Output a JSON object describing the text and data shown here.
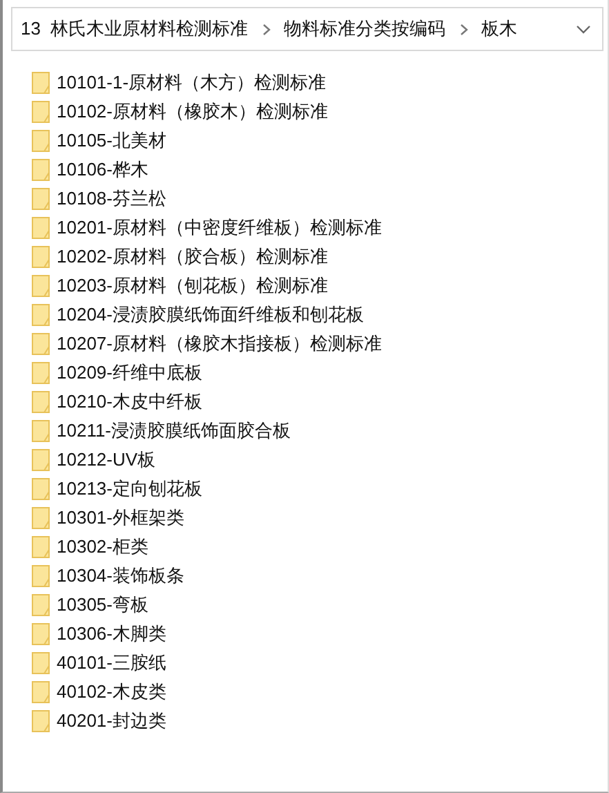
{
  "address_bar": {
    "breadcrumbs": [
      "13  林氏木业原材料检测标准",
      "物料标准分类按编码",
      "板木"
    ]
  },
  "folders": [
    {
      "name": "10101-1-原材料（木方）检测标准"
    },
    {
      "name": "10102-原材料（橡胶木）检测标准"
    },
    {
      "name": "10105-北美材"
    },
    {
      "name": "10106-桦木"
    },
    {
      "name": "10108-芬兰松"
    },
    {
      "name": "10201-原材料（中密度纤维板）检测标准"
    },
    {
      "name": "10202-原材料（胶合板）检测标准"
    },
    {
      "name": "10203-原材料（刨花板）检测标准"
    },
    {
      "name": "10204-浸渍胶膜纸饰面纤维板和刨花板"
    },
    {
      "name": "10207-原材料（橡胶木指接板）检测标准"
    },
    {
      "name": "10209-纤维中底板"
    },
    {
      "name": "10210-木皮中纤板"
    },
    {
      "name": "10211-浸渍胶膜纸饰面胶合板"
    },
    {
      "name": "10212-UV板"
    },
    {
      "name": "10213-定向刨花板"
    },
    {
      "name": "10301-外框架类"
    },
    {
      "name": "10302-柜类"
    },
    {
      "name": "10304-装饰板条"
    },
    {
      "name": "10305-弯板"
    },
    {
      "name": "10306-木脚类"
    },
    {
      "name": "40101-三胺纸"
    },
    {
      "name": "40102-木皮类"
    },
    {
      "name": "40201-封边类"
    }
  ]
}
